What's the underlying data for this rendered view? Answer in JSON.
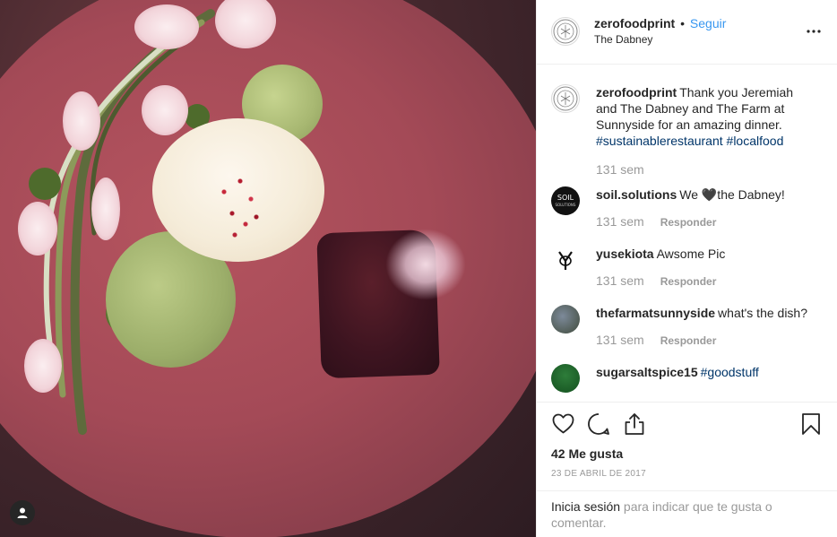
{
  "post": {
    "author": {
      "username": "zerofoodprint",
      "separator": "•",
      "follow_label": "Seguir",
      "location": "The Dabney"
    },
    "caption": {
      "username": "zerofoodprint",
      "text": "Thank you Jeremiah and The Dabney and The Farm at Sunnyside for an amazing dinner.",
      "hashtags": "#sustainablerestaurant #localfood",
      "time": "131 sem"
    },
    "comments": [
      {
        "username": "soil.solutions",
        "text": "We 🖤the Dabney!",
        "time": "131 sem",
        "reply_label": "Responder"
      },
      {
        "username": "yusekiota",
        "text": "Awsome Pic",
        "time": "131 sem",
        "reply_label": "Responder"
      },
      {
        "username": "thefarmatsunnyside",
        "text": "what's the dish?",
        "time": "131 sem",
        "reply_label": "Responder"
      },
      {
        "username": "sugarsaltspice15",
        "text": "#goodstuff"
      }
    ],
    "likes": "42 Me gusta",
    "date": "23 DE ABRIL DE 2017",
    "login_prompt": {
      "link": "Inicia sesión",
      "text": " para indicar que te gusta o comentar."
    },
    "icons": {
      "like": "heart-icon",
      "comment": "comment-bubble-icon",
      "share": "share-icon",
      "save": "bookmark-icon",
      "more": "more-options-icon",
      "profile": "user-profile-icon"
    },
    "colors": {
      "link_blue": "#3897f0",
      "hashtag": "#003569",
      "text": "#262626",
      "muted": "#999999"
    }
  }
}
